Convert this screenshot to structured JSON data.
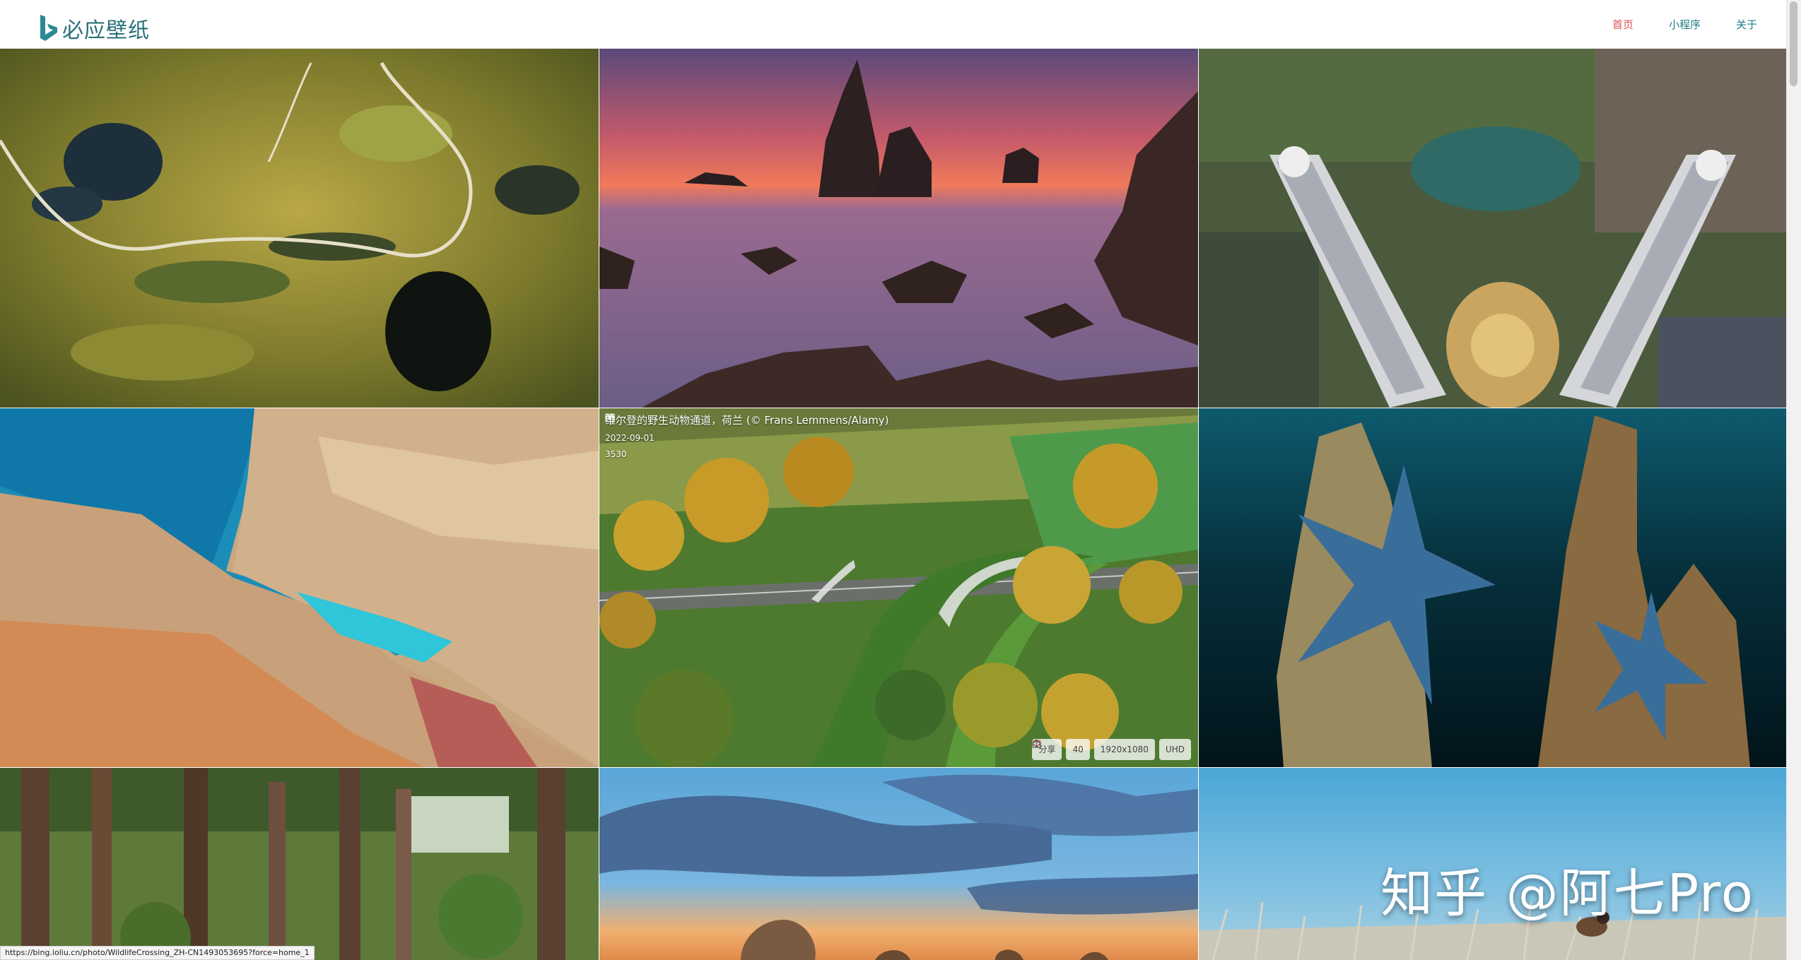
{
  "app": {
    "brand_name": "必应壁纸",
    "brand_color": "#2a6f7b"
  },
  "nav": [
    {
      "label": "首页",
      "active": true
    },
    {
      "label": "小程序",
      "active": false
    },
    {
      "label": "关于",
      "active": false
    }
  ],
  "grid": {
    "tiles": [
      {
        "name": "wallpaper-aerial-wetland"
      },
      {
        "name": "wallpaper-sea-stacks-sunset"
      },
      {
        "name": "wallpaper-petronas-towers"
      },
      {
        "name": "wallpaper-cliff-beach"
      },
      {
        "name": "wallpaper-wildlife-crossing"
      },
      {
        "name": "wallpaper-blue-starfish"
      },
      {
        "name": "wallpaper-pine-forest"
      },
      {
        "name": "wallpaper-sky-rocks"
      },
      {
        "name": "wallpaper-bird-grass"
      }
    ]
  },
  "hover_card": {
    "title": "维尔登的野生动物通道，荷兰 (© Frans Lemmens/Alamy)",
    "date": "2022-09-01",
    "views": "3530",
    "share_label": "分享",
    "likes": "40",
    "resolution_label": "1920x1080",
    "uhd_label": "UHD"
  },
  "watermark": "知乎 @阿七Pro",
  "status_url": "https://bing.ioliu.cn/photo/WildlifeCrossing_ZH-CN1493053695?force=home_1",
  "icons": [
    "bing-logo-icon",
    "calendar-icon",
    "eye-icon",
    "share-icon",
    "heart-icon",
    "download-icon"
  ]
}
